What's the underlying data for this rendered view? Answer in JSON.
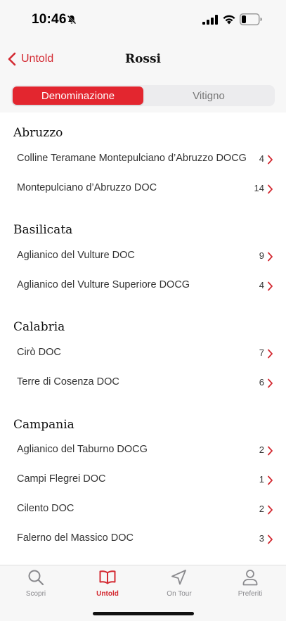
{
  "status": {
    "time": "10:46"
  },
  "nav": {
    "back_label": "Untold",
    "title": "Rossi"
  },
  "segments": {
    "left": "Denominazione",
    "right": "Vitigno",
    "selected": "Denominazione"
  },
  "accent_color": "#e3262f",
  "sections": [
    {
      "title": "Abruzzo",
      "items": [
        {
          "label": "Colline Teramane Montepulciano d’Abruzzo DOCG",
          "count": "4"
        },
        {
          "label": "Montepulciano d’Abruzzo DOC",
          "count": "14"
        }
      ]
    },
    {
      "title": "Basilicata",
      "items": [
        {
          "label": "Aglianico del Vulture DOC",
          "count": "9"
        },
        {
          "label": "Aglianico del Vulture Superiore DOCG",
          "count": "4"
        }
      ]
    },
    {
      "title": "Calabria",
      "items": [
        {
          "label": "Cirò DOC",
          "count": "7"
        },
        {
          "label": "Terre di Cosenza DOC",
          "count": "6"
        }
      ]
    },
    {
      "title": "Campania",
      "items": [
        {
          "label": "Aglianico del Taburno DOCG",
          "count": "2"
        },
        {
          "label": "Campi Flegrei DOC",
          "count": "1"
        },
        {
          "label": "Cilento DOC",
          "count": "2"
        },
        {
          "label": "Falerno del Massico DOC",
          "count": "3"
        }
      ]
    }
  ],
  "tabs": [
    {
      "label": "Scopri",
      "icon": "search-icon"
    },
    {
      "label": "Untold",
      "icon": "book-icon",
      "active": true
    },
    {
      "label": "On Tour",
      "icon": "navigation-arrow-icon"
    },
    {
      "label": "Preferiti",
      "icon": "person-icon"
    }
  ]
}
